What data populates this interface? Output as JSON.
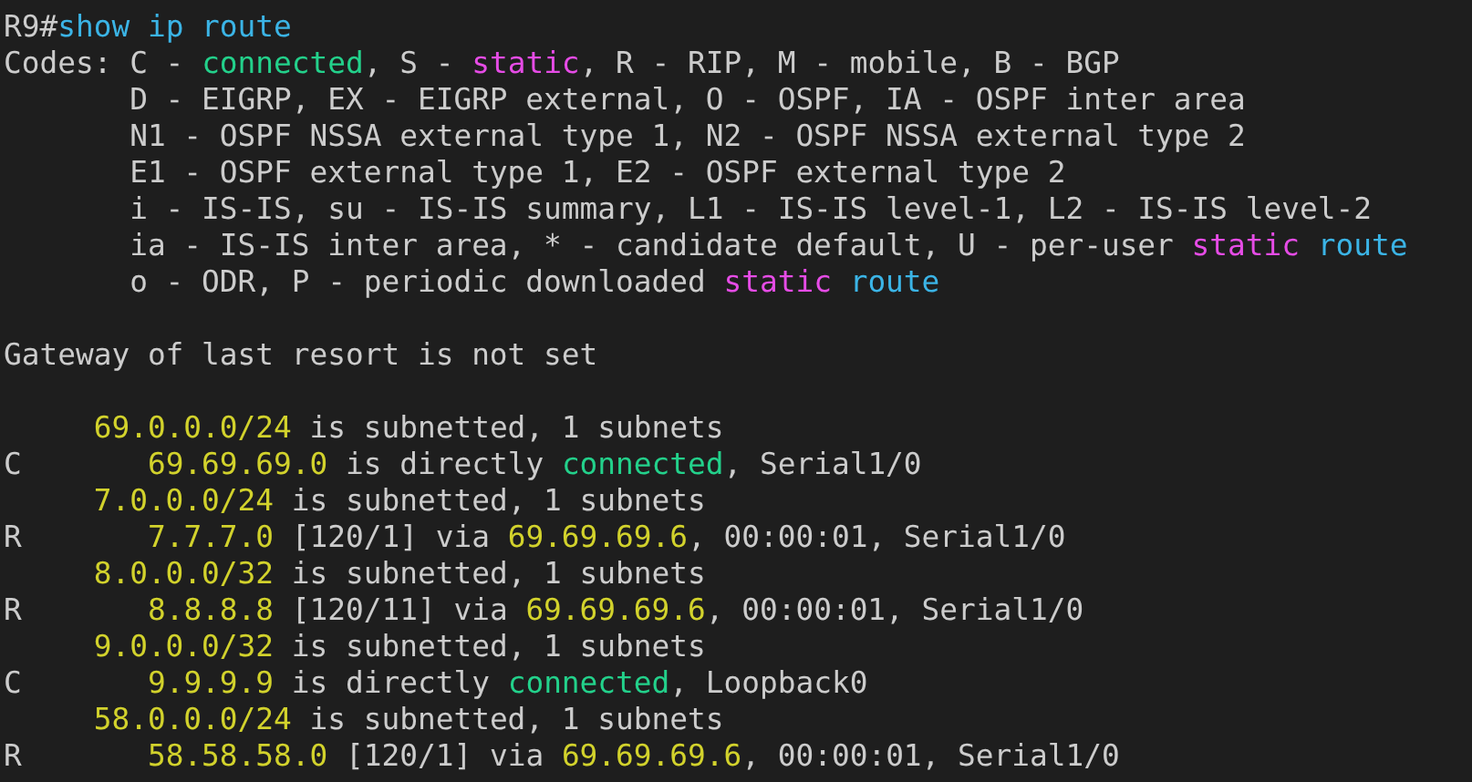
{
  "terminal": {
    "lines": [
      {
        "segments": [
          {
            "kind": "plain",
            "text": "R9#"
          },
          {
            "kind": "command",
            "text": "show ip route"
          }
        ]
      },
      {
        "segments": [
          {
            "kind": "plain",
            "text": "Codes: C - "
          },
          {
            "kind": "connected",
            "text": "connected"
          },
          {
            "kind": "plain",
            "text": ", S - "
          },
          {
            "kind": "static",
            "text": "static"
          },
          {
            "kind": "plain",
            "text": ", R - RIP, M - mobile, B - BGP"
          }
        ]
      },
      {
        "segments": [
          {
            "kind": "plain",
            "text": "       D - EIGRP, EX - EIGRP external, O - OSPF, IA - OSPF inter area"
          }
        ]
      },
      {
        "segments": [
          {
            "kind": "plain",
            "text": "       N1 - OSPF NSSA external type 1, N2 - OSPF NSSA external type 2"
          }
        ]
      },
      {
        "segments": [
          {
            "kind": "plain",
            "text": "       E1 - OSPF external type 1, E2 - OSPF external type 2"
          }
        ]
      },
      {
        "segments": [
          {
            "kind": "plain",
            "text": "       i - IS-IS, su - IS-IS summary, L1 - IS-IS level-1, L2 - IS-IS level-2"
          }
        ]
      },
      {
        "segments": [
          {
            "kind": "plain",
            "text": "       ia - IS-IS inter area, * - candidate default, U - per-user "
          },
          {
            "kind": "static",
            "text": "static"
          },
          {
            "kind": "route",
            "text": " route"
          }
        ]
      },
      {
        "segments": [
          {
            "kind": "plain",
            "text": "       o - ODR, P - periodic downloaded "
          },
          {
            "kind": "static",
            "text": "static"
          },
          {
            "kind": "route",
            "text": " route"
          }
        ]
      },
      {
        "blank_before": true,
        "segments": [
          {
            "kind": "plain",
            "text": "Gateway of last resort is not set"
          }
        ]
      },
      {
        "blank_before": true,
        "segments": [
          {
            "kind": "address",
            "text": "     69.0.0.0/24"
          },
          {
            "kind": "plain",
            "text": " is subnetted, 1 subnets"
          }
        ]
      },
      {
        "segments": [
          {
            "kind": "plain",
            "text": "C       "
          },
          {
            "kind": "address",
            "text": "69.69.69.0"
          },
          {
            "kind": "plain",
            "text": " is directly "
          },
          {
            "kind": "connected",
            "text": "connected"
          },
          {
            "kind": "plain",
            "text": ", Serial1/0"
          }
        ]
      },
      {
        "segments": [
          {
            "kind": "address",
            "text": "     7.0.0.0/24"
          },
          {
            "kind": "plain",
            "text": " is subnetted, 1 subnets"
          }
        ]
      },
      {
        "segments": [
          {
            "kind": "plain",
            "text": "R       "
          },
          {
            "kind": "address",
            "text": "7.7.7.0"
          },
          {
            "kind": "plain",
            "text": " [120/1] via "
          },
          {
            "kind": "address",
            "text": "69.69.69.6"
          },
          {
            "kind": "plain",
            "text": ", 00:00:01, Serial1/0"
          }
        ]
      },
      {
        "segments": [
          {
            "kind": "address",
            "text": "     8.0.0.0/32"
          },
          {
            "kind": "plain",
            "text": " is subnetted, 1 subnets"
          }
        ]
      },
      {
        "segments": [
          {
            "kind": "plain",
            "text": "R       "
          },
          {
            "kind": "address",
            "text": "8.8.8.8"
          },
          {
            "kind": "plain",
            "text": " [120/11] via "
          },
          {
            "kind": "address",
            "text": "69.69.69.6"
          },
          {
            "kind": "plain",
            "text": ", 00:00:01, Serial1/0"
          }
        ]
      },
      {
        "segments": [
          {
            "kind": "address",
            "text": "     9.0.0.0/32"
          },
          {
            "kind": "plain",
            "text": " is subnetted, 1 subnets"
          }
        ]
      },
      {
        "segments": [
          {
            "kind": "plain",
            "text": "C       "
          },
          {
            "kind": "address",
            "text": "9.9.9.9"
          },
          {
            "kind": "plain",
            "text": " is directly "
          },
          {
            "kind": "connected",
            "text": "connected"
          },
          {
            "kind": "plain",
            "text": ", Loopback0"
          }
        ]
      },
      {
        "segments": [
          {
            "kind": "address",
            "text": "     58.0.0.0/24"
          },
          {
            "kind": "plain",
            "text": " is subnetted, 1 subnets"
          }
        ]
      },
      {
        "segments": [
          {
            "kind": "plain",
            "text": "R       "
          },
          {
            "kind": "address",
            "text": "58.58.58.0"
          },
          {
            "kind": "plain",
            "text": " [120/1] via "
          },
          {
            "kind": "address",
            "text": "69.69.69.6"
          },
          {
            "kind": "plain",
            "text": ", 00:00:01, Serial1/0"
          }
        ]
      }
    ]
  }
}
